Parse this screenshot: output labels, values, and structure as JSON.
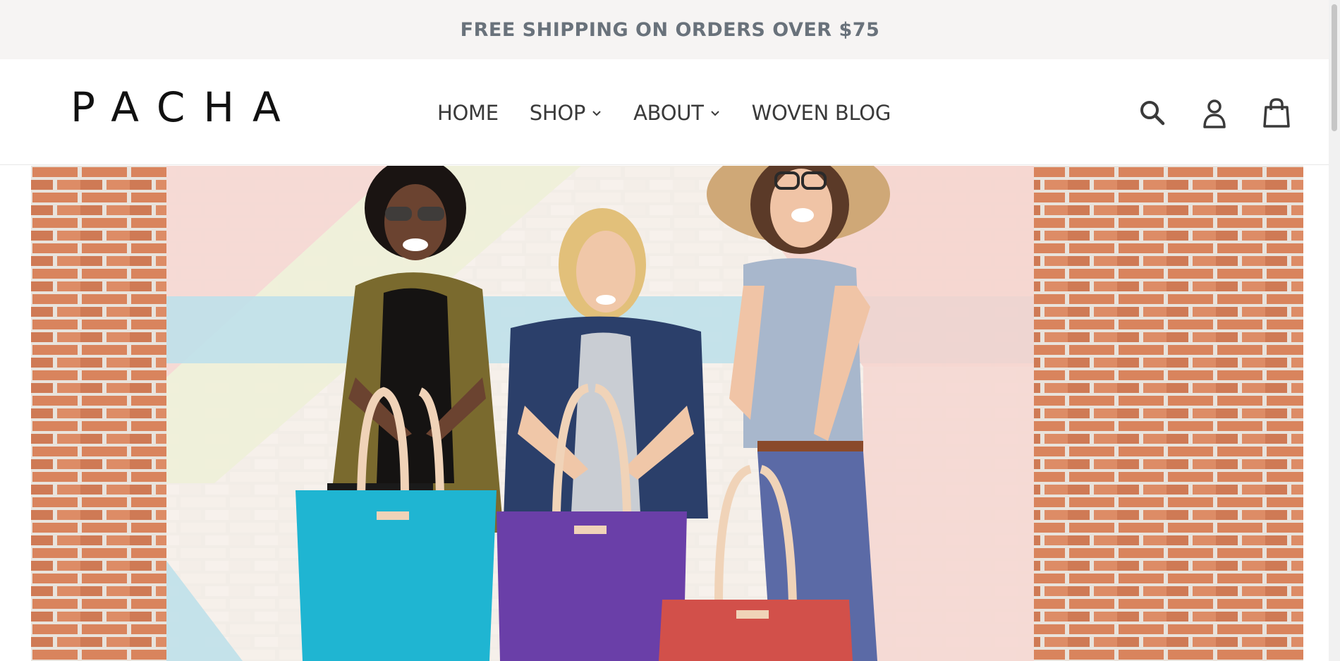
{
  "announcement": {
    "text": "FREE SHIPPING ON ORDERS OVER $75"
  },
  "header": {
    "logo": "PACHA",
    "nav": [
      {
        "label": "HOME",
        "has_dropdown": false
      },
      {
        "label": "SHOP",
        "has_dropdown": true
      },
      {
        "label": "ABOUT",
        "has_dropdown": true
      },
      {
        "label": "WOVEN BLOG",
        "has_dropdown": false
      }
    ],
    "icons": [
      "search-icon",
      "account-icon",
      "cart-icon"
    ]
  },
  "hero": {
    "image": "three-women-holding-tote-bags-against-brick-wall",
    "bag_colors": [
      "#1fb5d2",
      "#6a3fa8",
      "#d2504a"
    ]
  },
  "colors": {
    "announcement_bg": "#f6f4f3",
    "announcement_text": "#69727b",
    "nav_text": "#3a3a3a",
    "brick": "#d98a62"
  }
}
